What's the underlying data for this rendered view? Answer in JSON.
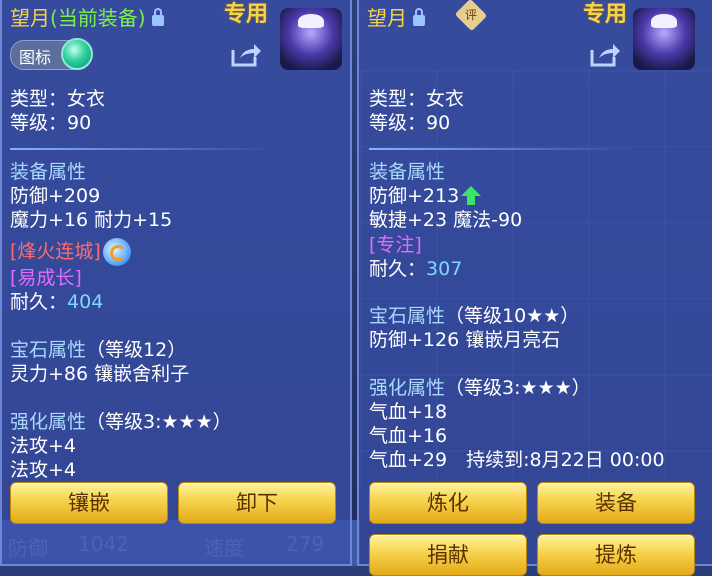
{
  "left_panel": {
    "title_name": "望月",
    "title_tag": "(当前装备)",
    "badge": "专用",
    "toggle_label": "图标",
    "type_line": "类型：女衣",
    "level_line": "等级：90",
    "equip_attr_title": "装备属性",
    "attr_lines": [
      "防御+209",
      "魔力+16 耐力+15"
    ],
    "special_effect": "[烽火连城]",
    "special_skill": "[易成长]",
    "durability_label": "耐久：",
    "durability_value": "404",
    "gem_title": "宝石属性",
    "gem_level": "（等级12）",
    "gem_line": "灵力+86 镶嵌舍利子",
    "strengthen_title": "强化属性",
    "strengthen_level": "（等级3:★★★）",
    "strengthen_lines": [
      "法攻+4",
      "法攻+4"
    ],
    "buttons": [
      "镶嵌",
      "卸下"
    ]
  },
  "right_panel": {
    "title_name": "望月",
    "rating_badge": "评",
    "badge": "专用",
    "type_line": "类型：女衣",
    "level_line": "等级：90",
    "equip_attr_title": "装备属性",
    "attr_lines": [
      "防御+213",
      "敏捷+23 魔法-90"
    ],
    "special_skill": "[专注]",
    "durability_label": "耐久：",
    "durability_value": "307",
    "gem_title": "宝石属性",
    "gem_level": "（等级10★★）",
    "gem_line": "防御+126 镶嵌月亮石",
    "strengthen_title": "强化属性",
    "strengthen_level": "（等级3:★★★）",
    "strengthen_lines": [
      "气血+18",
      "气血+16"
    ],
    "last_line": "气血+29　持续到:8月22日 00:00",
    "buttons": [
      "炼化",
      "装备",
      "捐献",
      "提炼"
    ]
  },
  "background": {
    "bottom_left": [
      "防御",
      "1042",
      "速度",
      "279"
    ]
  },
  "icons": {
    "lock": "lock-icon",
    "share": "share-icon",
    "refresh": "refresh-icon",
    "upgrade": "green-up-arrow-icon"
  },
  "colors": {
    "title": "#f4d54a",
    "current_tag": "#7cf04a",
    "section": "#a8d8ff",
    "red_effect": "#ff6b6b",
    "pink_skill": "#e26bff",
    "durability": "#7fd7ff",
    "button": "#f6d24a"
  }
}
